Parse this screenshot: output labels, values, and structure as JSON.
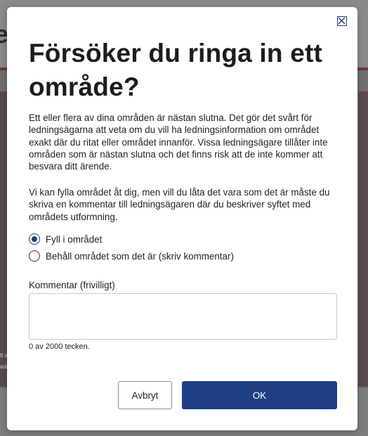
{
  "background": {
    "header_fragment": "e",
    "side_snippet": "tt a ada"
  },
  "dialog": {
    "title": "Försöker du ringa in ett område?",
    "paragraph1": "Ett eller flera av dina områden är nästan slutna. Det gör det svårt för ledningsägarna att veta om du vill ha ledningsinformation om området exakt där du ritat eller området innanför. Vissa ledningsägare tillåter inte områden som är nästan slutna och det finns risk att de inte kommer att besvara ditt ärende.",
    "paragraph2": "Vi kan fylla området åt dig, men vill du låta det vara som det är måste du skriva en kommentar till ledningsägaren där du beskriver syftet med områdets utformning.",
    "options": [
      {
        "label": "Fyll i området",
        "selected": true
      },
      {
        "label": "Behåll området som det är (skriv kommentar)",
        "selected": false
      }
    ],
    "comment_label": "Kommentar (frivilligt)",
    "comment_value": "",
    "char_count": "0 av 2000 tecken.",
    "cancel_label": "Avbryt",
    "ok_label": "OK",
    "close_icon": "close-square-icon"
  },
  "colors": {
    "primary": "#1e3f86",
    "overlay": "#7a7a7a",
    "text": "#222222"
  }
}
